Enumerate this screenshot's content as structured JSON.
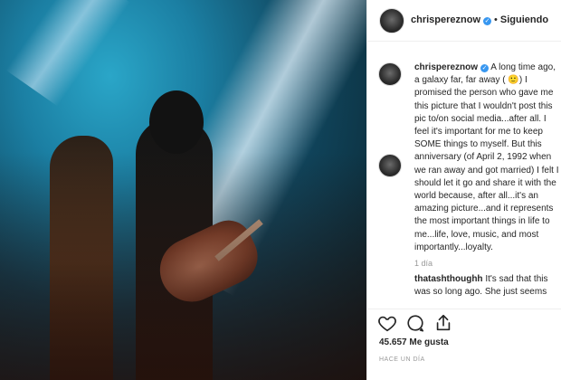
{
  "header": {
    "username": "chrisperez​now",
    "verified_icon": "verified-badge-icon",
    "separator": "•",
    "follow_label": "Siguiendo"
  },
  "caption": {
    "username": "chrisperez​now",
    "text": "A long time ago, a galaxy far, far away ( 🙂) I promised the person who gave me this picture that I wouldn't post this pic to/on social media...after all. I feel it's important for me to keep SOME things to myself. But this anniversary (of April 2, 1992 when we ran away and got married) I felt I should let it go and share it with the world because, after all...it's an amazing picture...and it represents the most important things in life to me...life, love, music, and most importantly...loyalty.",
    "time": "1 día"
  },
  "comment": {
    "username": "thatashthoughh",
    "text": "It's sad that this was so long ago. She just seems"
  },
  "actions": {
    "icons": [
      "heart-icon",
      "comment-icon",
      "share-icon"
    ],
    "likes_count": "45.657",
    "likes_label": "Me gusta",
    "date": "HACE UN DÍA"
  },
  "colors": {
    "verified": "#3897f0",
    "meta_text": "#999999",
    "border": "#efefef"
  }
}
